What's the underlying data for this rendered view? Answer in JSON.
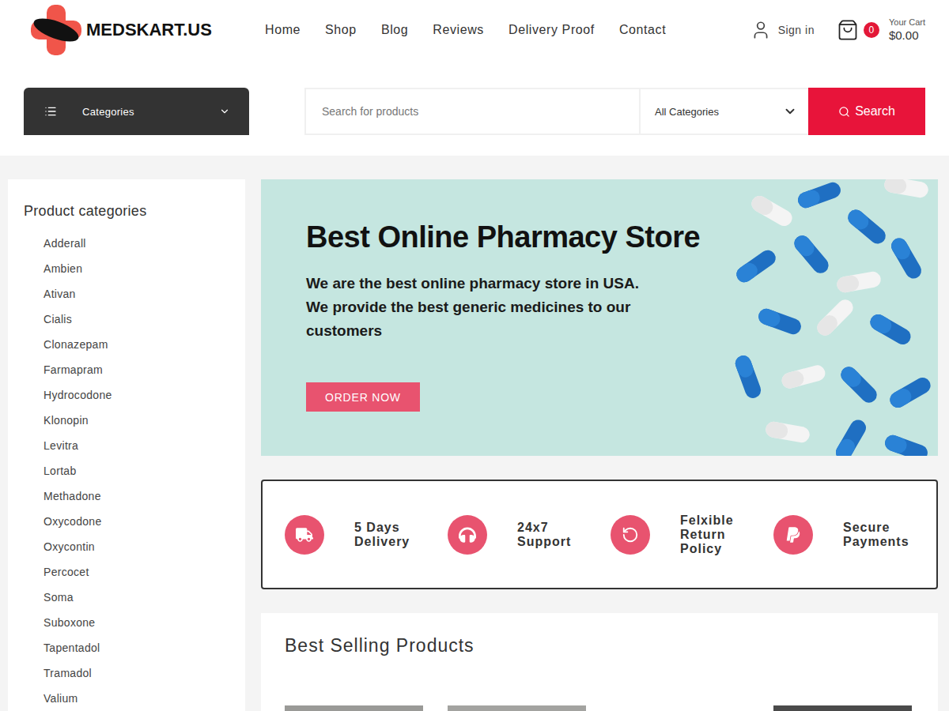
{
  "logo": {
    "text": "MEDSKART.US"
  },
  "nav": [
    "Home",
    "Shop",
    "Blog",
    "Reviews",
    "Delivery Proof",
    "Contact"
  ],
  "account": {
    "label": "Sign in"
  },
  "cart": {
    "count": "0",
    "label": "Your Cart",
    "total": "$0.00"
  },
  "categories_button": {
    "label": "Categories"
  },
  "search": {
    "placeholder": "Search for products",
    "category": "All Categories",
    "button": "Search"
  },
  "sidebar": {
    "title": "Product categories",
    "items": [
      "Adderall",
      "Ambien",
      "Ativan",
      "Cialis",
      "Clonazepam",
      "Farmapram",
      "Hydrocodone",
      "Klonopin",
      "Levitra",
      "Lortab",
      "Methadone",
      "Oxycodone",
      "Oxycontin",
      "Percocet",
      "Soma",
      "Suboxone",
      "Tapentadol",
      "Tramadol",
      "Valium"
    ]
  },
  "banner": {
    "title": "Best Online Pharmacy Store",
    "subtitle": "We are the best online pharmacy store in USA. We provide the best generic medicines to our customers",
    "button": "ORDER NOW"
  },
  "features": [
    {
      "label": "5 Days Delivery",
      "kind": "truck"
    },
    {
      "label": "24x7 Support",
      "kind": "headphones"
    },
    {
      "label": "Felxible Return Policy",
      "kind": "return"
    },
    {
      "label": "Secure Payments",
      "kind": "paypal"
    }
  ],
  "best_selling": {
    "title": "Best Selling Products",
    "products": [
      {
        "color": "#9a9a97"
      },
      {
        "color": "#a3a3a0"
      },
      {
        "color": "#ffffff"
      },
      {
        "color": "#4a4a4a"
      }
    ]
  }
}
